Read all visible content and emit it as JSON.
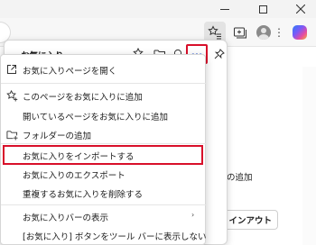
{
  "toolbar": {
    "more_label": "⋮"
  },
  "page": {
    "add_text": "イルの追加",
    "signin_label": "インアウト"
  },
  "panel": {
    "title": "お気に入り",
    "more_label": "···"
  },
  "menu": {
    "items": [
      {
        "label": "お気に入りページを開く",
        "icon": "open-external-icon"
      },
      {
        "label": "このページをお気に入りに追加",
        "icon": "add-favorite-icon"
      },
      {
        "label": "開いているページをお気に入りに追加",
        "icon": ""
      },
      {
        "label": "フォルダーの追加",
        "icon": "add-folder-icon"
      },
      {
        "label": "お気に入りをインポートする",
        "icon": ""
      },
      {
        "label": "お気に入りのエクスポート",
        "icon": ""
      },
      {
        "label": "重複するお気に入りを削除する",
        "icon": ""
      },
      {
        "label": "お気に入りバーの表示",
        "icon": "",
        "chevron": "›"
      },
      {
        "label": "[お気に入り] ボタンをツール バーに表示しない",
        "icon": ""
      }
    ]
  },
  "colors": {
    "highlight": "#d80f2a",
    "accent": "#2f5bd3"
  }
}
